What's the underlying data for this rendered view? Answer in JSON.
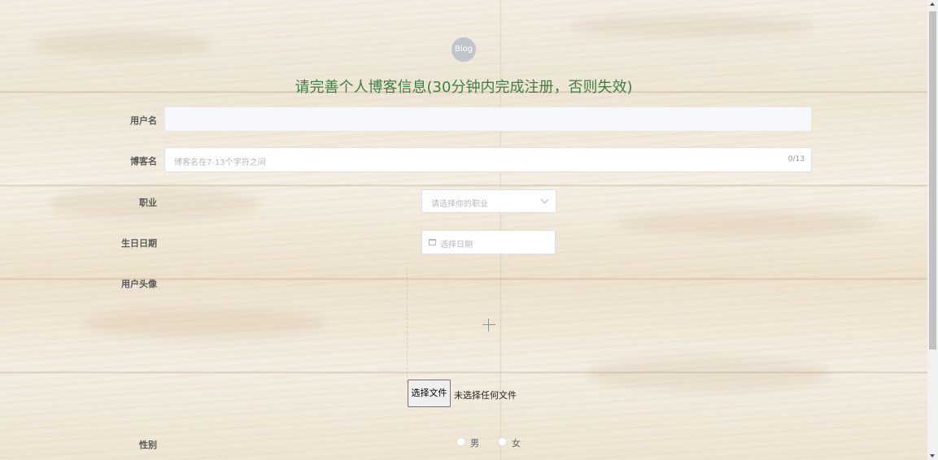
{
  "logo": {
    "text": "Blog"
  },
  "title": "请完善个人博客信息(30分钟内完成注册，否则失效)",
  "form": {
    "username": {
      "label": "用户名",
      "value": ""
    },
    "blogname": {
      "label": "博客名",
      "placeholder": "博客名在7-13个字符之间",
      "counter": "0/13"
    },
    "occupation": {
      "label": "职业",
      "placeholder": "请选择你的职业"
    },
    "birthday": {
      "label": "生日日期",
      "placeholder": "选择日期"
    },
    "avatar": {
      "label": "用户头像",
      "file_button": "选择文件",
      "file_status": "未选择任何文件"
    },
    "gender": {
      "label": "性别",
      "options": [
        "男",
        "女"
      ]
    }
  },
  "colors": {
    "title": "#3f7f45",
    "logo_bg": "#c0c4cc"
  }
}
